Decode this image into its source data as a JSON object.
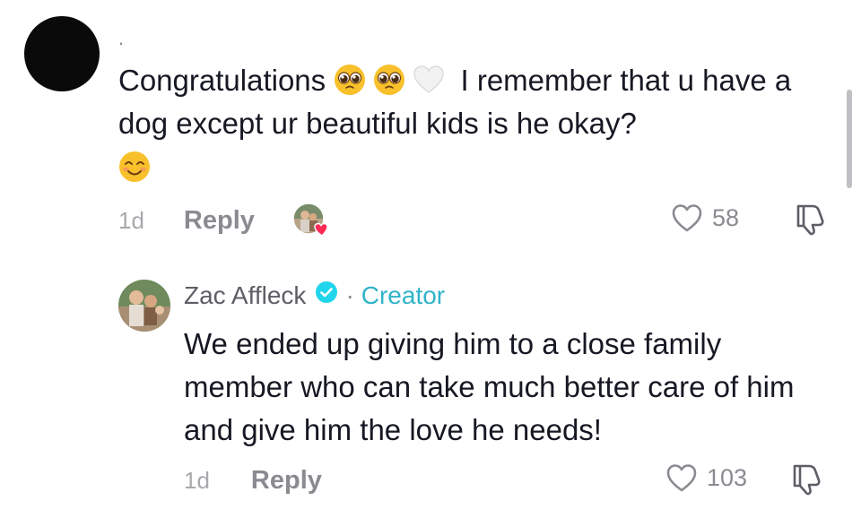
{
  "comment": {
    "username": ".",
    "text_before_emoji": "Congratulations",
    "text_after_emoji": "I remember that u have a dog except ur beautiful kids is he okay?",
    "emojis": [
      "pleading-face-emoji",
      "pleading-face-emoji",
      "white-heart-emoji",
      "smiling-face-emoji"
    ],
    "time": "1d",
    "reply_label": "Reply",
    "like_count": "58"
  },
  "reply": {
    "author": "Zac Affleck",
    "separator": "·",
    "badge": "Creator",
    "text": "We ended up giving him to a close family member who can take much better care of him and give him the love he needs!",
    "time": "1d",
    "reply_label": "Reply",
    "like_count": "103"
  },
  "colors": {
    "creator_accent": "#2fb4c8",
    "liked_by_creator_heart": "#fe2c55",
    "muted_text": "#8a8b91"
  }
}
